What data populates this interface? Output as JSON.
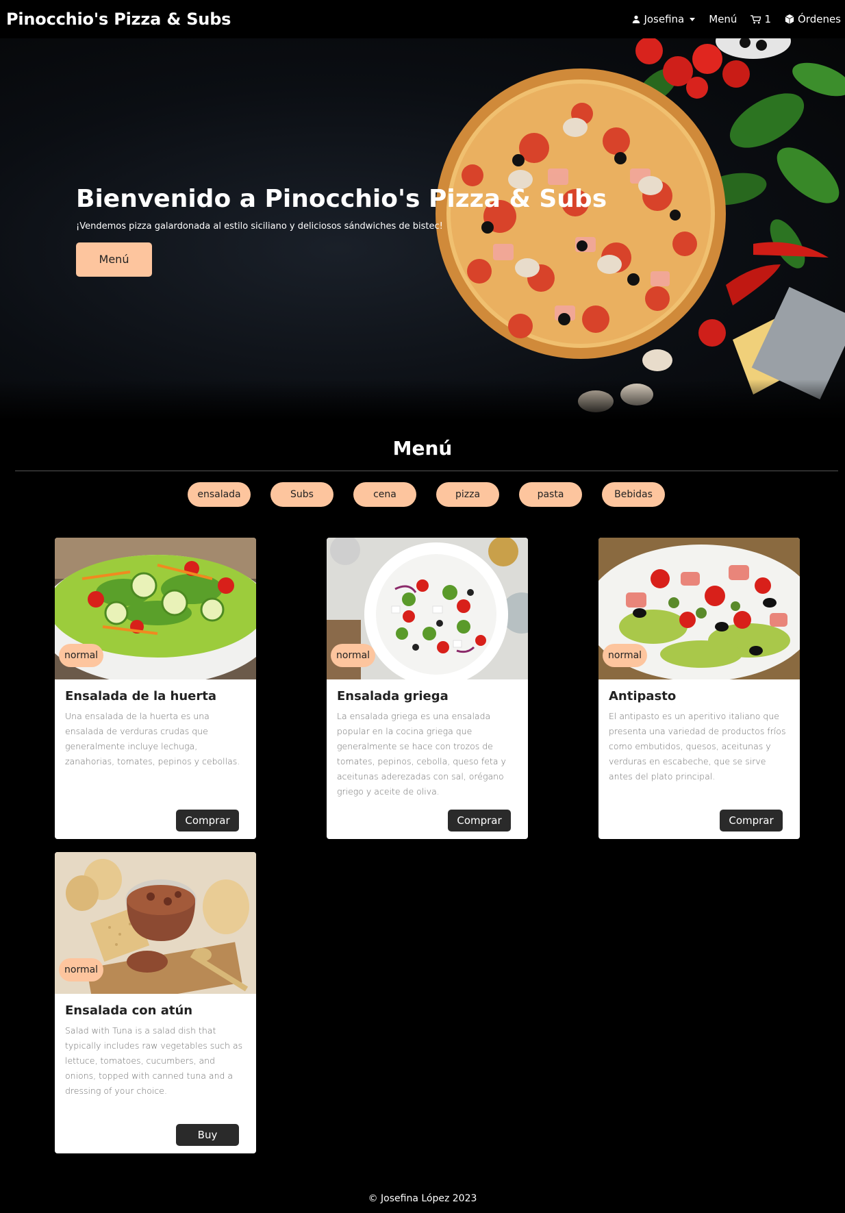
{
  "nav": {
    "brand": "Pinocchio's Pizza & Subs",
    "user": "Josefina",
    "menu": "Menú",
    "cart_count": "1",
    "orders": "Órdenes",
    "icons": [
      "user-icon",
      "caret-down-icon",
      "cart-icon",
      "box-icon"
    ]
  },
  "hero": {
    "title": "Bienvenido a Pinocchio's Pizza & Subs",
    "subtitle": "¡Vendemos pizza galardonada al estilo siciliano y deliciosos sándwiches de bistec!",
    "button": "Menú"
  },
  "menu": {
    "title": "Menú",
    "filters": [
      "ensalada",
      "Subs",
      "cena",
      "pizza",
      "pasta",
      "Bebidas"
    ]
  },
  "cards": [
    {
      "badge": "normal",
      "title": "Ensalada de la huerta",
      "text": "Una ensalada de la huerta es una ensalada de verduras crudas que generalmente incluye lechuga, zanahorias, tomates, pepinos y cebollas.",
      "button": "Comprar"
    },
    {
      "badge": "normal",
      "title": "Ensalada griega",
      "text": "La ensalada griega es una ensalada popular en la cocina griega que generalmente se hace con trozos de tomates, pepinos, cebolla, queso feta y aceitunas aderezadas con sal, orégano griego y aceite de oliva.",
      "button": "Comprar"
    },
    {
      "badge": "normal",
      "title": "Antipasto",
      "text": "El antipasto es un aperitivo italiano que presenta una variedad de productos fríos como embutidos, quesos, aceitunas y verduras en escabeche, que se sirve antes del plato principal.",
      "button": "Comprar"
    },
    {
      "badge": "normal",
      "title": "Ensalada con atún",
      "text": "Salad with Tuna is a salad dish that typically includes raw vegetables such as lettuce, tomatoes, cucumbers, and onions, topped with canned tuna and a dressing of your choice.",
      "button": "Buy"
    }
  ],
  "footer": "© Josefina López 2023",
  "colors": {
    "accent": "#fdc59e",
    "background": "#000000",
    "card": "#ffffff",
    "button_dark": "#2a2a2a"
  }
}
